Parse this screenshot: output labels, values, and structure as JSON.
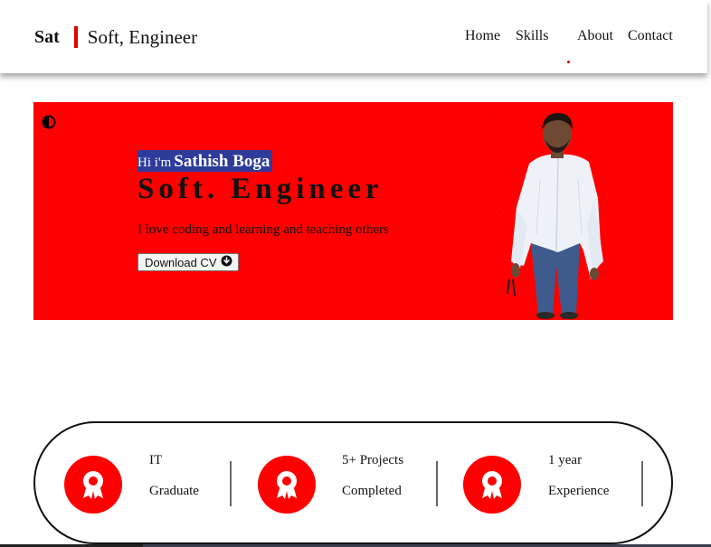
{
  "header": {
    "brand": "Sat",
    "title": "Soft, Engineer",
    "nav": [
      {
        "label": "Home"
      },
      {
        "label": "Skills"
      },
      {
        "label": "About"
      },
      {
        "label": "Contact"
      }
    ]
  },
  "hero": {
    "greeting": "Hi i'm",
    "name": "Sathish Boga",
    "role": "Soft. Engineer",
    "tagline": "I love coding and learning and teaching others",
    "cv_button": "Download CV",
    "theme_icon": "contrast-toggle-icon",
    "download_icon": "download-circle-icon"
  },
  "stats": [
    {
      "icon": "award-badge-icon",
      "line1": "IT",
      "line2": "Graduate"
    },
    {
      "icon": "award-badge-icon",
      "line1": "5+ Projects",
      "line2": "Completed"
    },
    {
      "icon": "award-badge-icon",
      "line1": "1 year",
      "line2": "Experience"
    }
  ],
  "colors": {
    "accent": "#ff0000",
    "name_highlight": "#2f3b9a",
    "text": "#111111"
  }
}
